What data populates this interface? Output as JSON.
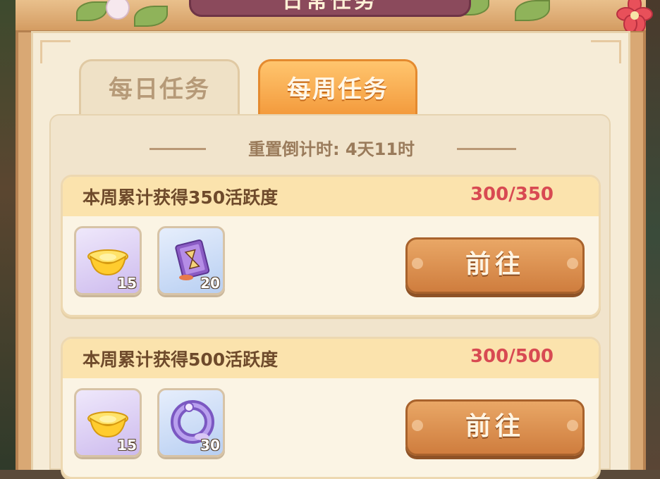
{
  "window": {
    "title": "日常任务"
  },
  "tabs": [
    {
      "label": "每日任务",
      "active": false
    },
    {
      "label": "每周任务",
      "active": true
    }
  ],
  "reset": {
    "text": "重置倒计时: 4天11时"
  },
  "tasks": [
    {
      "title": "本周累计获得350活跃度",
      "progress": "300/350",
      "rewards": [
        {
          "icon": "gold-ingot-icon",
          "count": "15"
        },
        {
          "icon": "hourglass-card-icon",
          "count": "20"
        }
      ],
      "button": "前往"
    },
    {
      "title": "本周累计获得500活跃度",
      "progress": "300/500",
      "rewards": [
        {
          "icon": "gold-ingot-icon",
          "count": "15"
        },
        {
          "icon": "purple-ring-icon",
          "count": "30"
        }
      ],
      "button": "前往"
    }
  ],
  "colors": {
    "accent": "#f39a3c",
    "progress": "#d84a52",
    "button": "#cf7d3e"
  }
}
